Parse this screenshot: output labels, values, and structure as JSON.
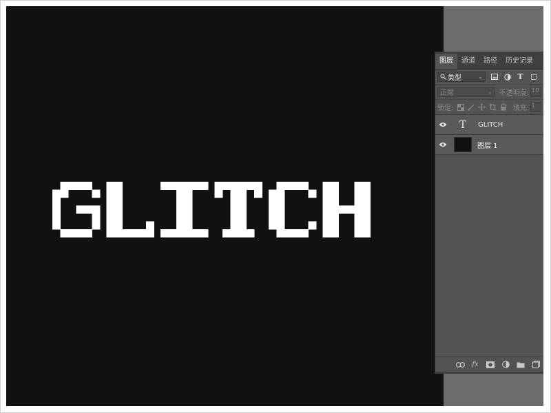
{
  "canvas": {
    "text": "GLITCH",
    "background": "#111111",
    "text_color": "#ffffff"
  },
  "layers_panel": {
    "tabs": [
      {
        "label": "图层",
        "active": true
      },
      {
        "label": "通道",
        "active": false
      },
      {
        "label": "路径",
        "active": false
      },
      {
        "label": "历史记录",
        "active": false
      }
    ],
    "filter": {
      "search_icon": "search-icon",
      "label": "类型",
      "icons": [
        "image-filter-icon",
        "adjustment-filter-icon",
        "type-filter-icon",
        "shape-filter-icon"
      ]
    },
    "blend_mode": "正常",
    "opacity_label": "不透明度:",
    "opacity_value": "10",
    "lock_label": "锁定:",
    "fill_label": "填充:",
    "fill_value": "1",
    "layers": [
      {
        "type": "text",
        "thumb": "T",
        "name": "GLITCH",
        "visible": true
      },
      {
        "type": "pixel",
        "thumb": "",
        "name": "图层 1",
        "visible": true
      }
    ],
    "footer_icons": [
      "link-icon",
      "fx-icon",
      "mask-icon",
      "adjustment-icon",
      "folder-icon",
      "new-layer-icon"
    ],
    "fx_label": "fx"
  }
}
